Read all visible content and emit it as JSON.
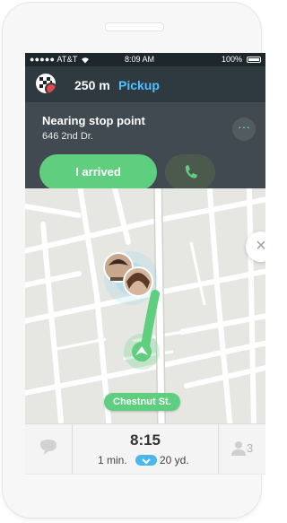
{
  "status": {
    "carrier": "●●●●● AT&T",
    "time": "8:09 AM",
    "battery": "100%"
  },
  "nav": {
    "distance": "250 m",
    "action": "Pickup"
  },
  "stop": {
    "title": "Nearing stop point",
    "address": "646 2nd Dr.",
    "more": "···",
    "arrived_label": "I arrived"
  },
  "map": {
    "street": "Chestnut St."
  },
  "bottom": {
    "eta_time": "8:15",
    "eta_min": "1 min.",
    "eta_dist": "20 yd.",
    "riders": "3"
  },
  "colors": {
    "accent_green": "#5fce7e",
    "accent_blue": "#4cc3ff",
    "dark": "#2f3a40"
  },
  "icons": [
    "wifi-icon",
    "checkered-flag-icon",
    "more-icon",
    "phone-icon",
    "close-icon",
    "chat-icon",
    "person-icon",
    "direction-arrow-icon"
  ]
}
